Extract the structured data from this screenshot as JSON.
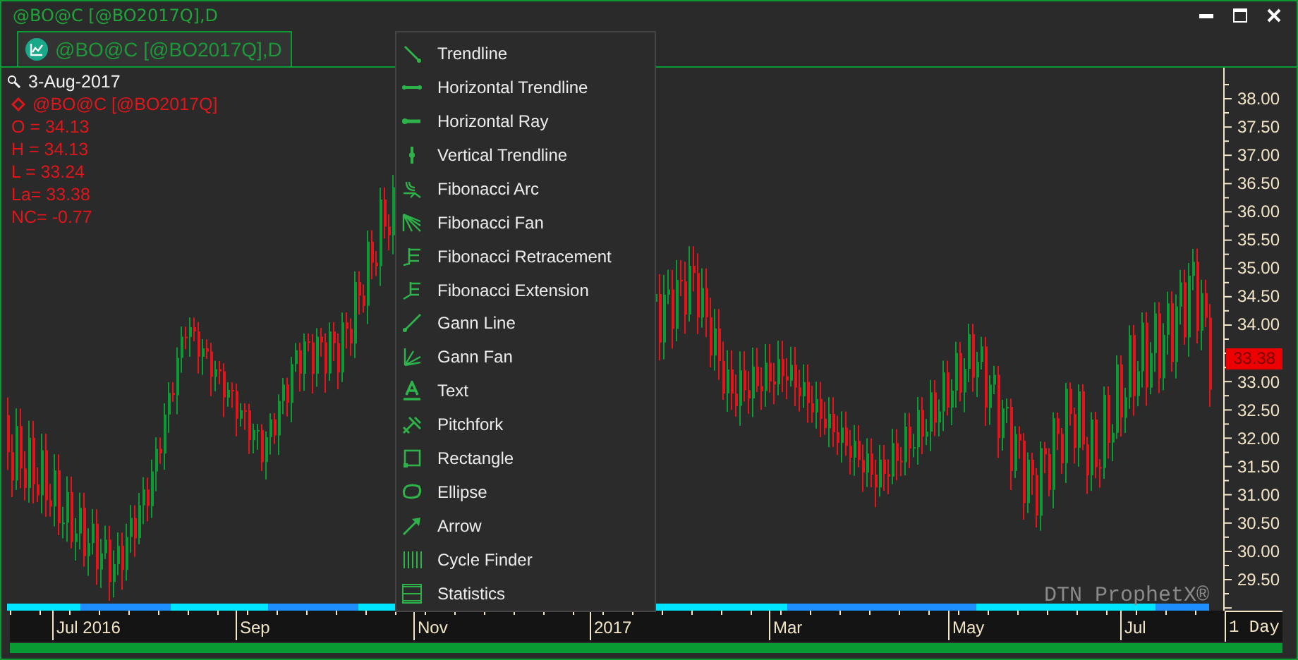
{
  "window": {
    "title": "@BO@C [@BO2017Q],D"
  },
  "tab": {
    "label": "@BO@C [@BO2017Q],D",
    "selected": true
  },
  "legend": {
    "date": "3-Aug-2017",
    "symbol": "@BO@C [@BO2017Q]",
    "lines": [
      "O = 34.13",
      "H = 34.13",
      "L = 33.24",
      "La= 33.38",
      "NC= -0.77"
    ]
  },
  "menu": {
    "items": [
      {
        "label": "Trendline",
        "kind": "trendline"
      },
      {
        "label": "Horizontal Trendline",
        "kind": "htrend"
      },
      {
        "label": "Horizontal Ray",
        "kind": "hray"
      },
      {
        "label": "Vertical Trendline",
        "kind": "vtrend"
      },
      {
        "label": "Fibonacci Arc",
        "kind": "fibarc"
      },
      {
        "label": "Fibonacci Fan",
        "kind": "fibfan"
      },
      {
        "label": "Fibonacci Retracement",
        "kind": "fibret"
      },
      {
        "label": "Fibonacci Extension",
        "kind": "fibext"
      },
      {
        "label": "Gann Line",
        "kind": "gannline"
      },
      {
        "label": "Gann Fan",
        "kind": "gannfan"
      },
      {
        "label": "Text",
        "kind": "text"
      },
      {
        "label": "Pitchfork",
        "kind": "pitchfork"
      },
      {
        "label": "Rectangle",
        "kind": "rect"
      },
      {
        "label": "Ellipse",
        "kind": "ellipse"
      },
      {
        "label": "Arrow",
        "kind": "arrow"
      },
      {
        "label": "Cycle Finder",
        "kind": "cycle"
      },
      {
        "label": "Statistics",
        "kind": "stats"
      }
    ]
  },
  "price_axis": {
    "ticks_above": [
      "38.00",
      "37.50",
      "37.00",
      "36.50",
      "36.00",
      "35.50",
      "35.00",
      "34.50",
      "34.00"
    ],
    "last_price": "33.38",
    "ticks_below": [
      "33.00",
      "32.50",
      "32.00",
      "31.50",
      "31.00",
      "30.50",
      "30.00",
      "29.50"
    ]
  },
  "time_axis": {
    "labels": [
      "Jul 2016",
      "Sep",
      "Nov",
      "2017",
      "Mar",
      "May",
      "Jul"
    ],
    "interval": "1 Day"
  },
  "branding": "DTN ProphetX®"
}
